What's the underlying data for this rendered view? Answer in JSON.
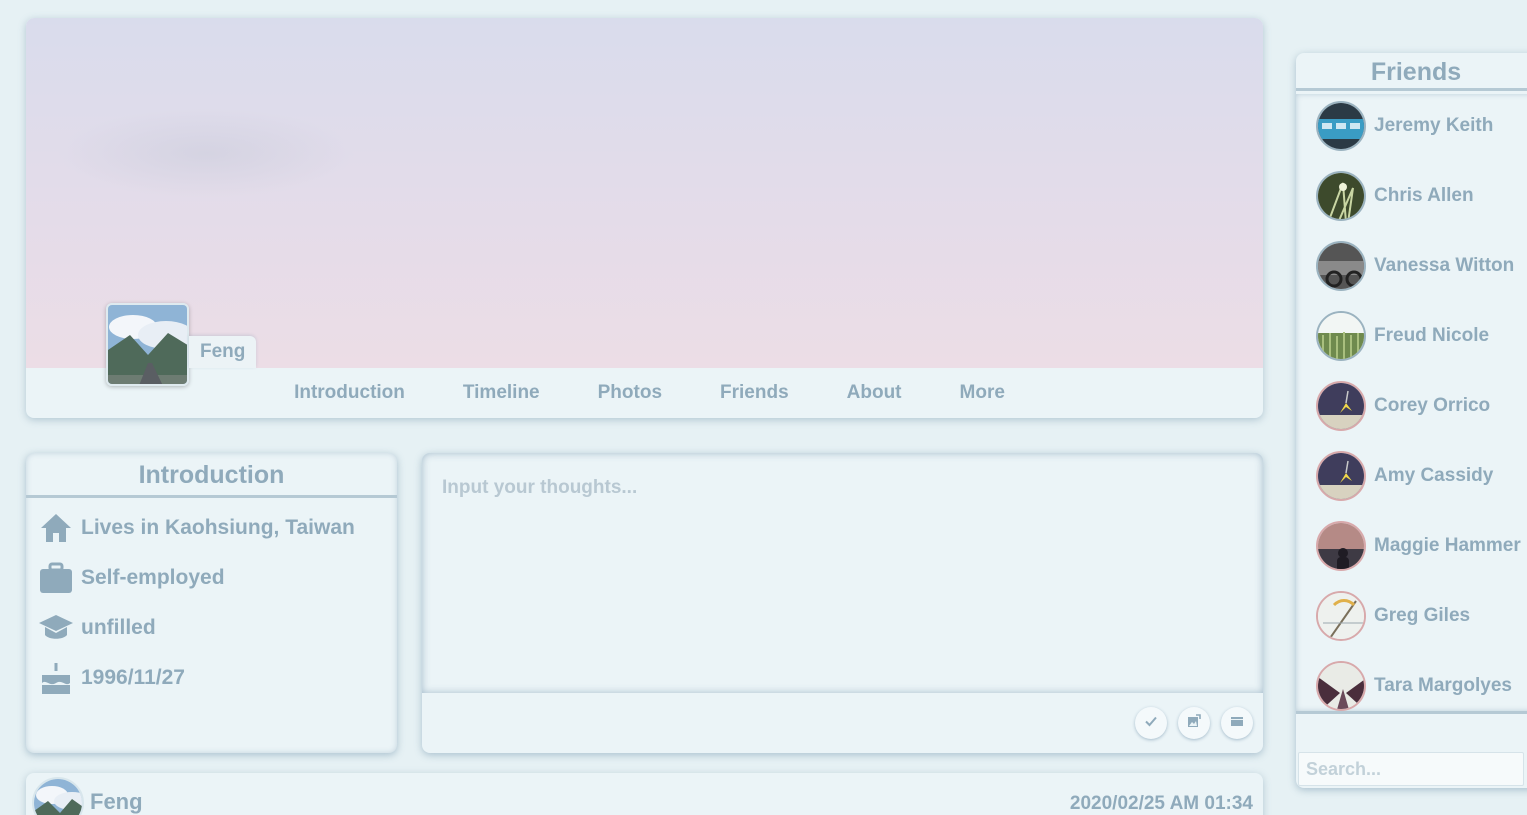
{
  "profile": {
    "name": "Feng",
    "nav_tabs": [
      "Introduction",
      "Timeline",
      "Photos",
      "Friends",
      "About",
      "More"
    ]
  },
  "intro": {
    "title": "Introduction",
    "items": [
      {
        "icon": "home-icon",
        "text": "Lives in Kaohsiung, Taiwan"
      },
      {
        "icon": "briefcase-icon",
        "text": "Self-employed"
      },
      {
        "icon": "graduation-cap-icon",
        "text": "unfilled"
      },
      {
        "icon": "birthday-cake-icon",
        "text": "1996/11/27"
      }
    ]
  },
  "composer": {
    "placeholder": "Input your thoughts...",
    "actions": [
      "check-icon",
      "image-icon",
      "video-icon"
    ]
  },
  "post": {
    "author": "Feng",
    "timestamp": "2020/02/25 AM 01:34"
  },
  "friends": {
    "title": "Friends",
    "items": [
      {
        "name": "Jeremy Keith"
      },
      {
        "name": "Chris Allen"
      },
      {
        "name": "Vanessa Witton"
      },
      {
        "name": "Freud Nicole"
      },
      {
        "name": "Corey Orrico"
      },
      {
        "name": "Amy Cassidy"
      },
      {
        "name": "Maggie Hammer"
      },
      {
        "name": "Greg Giles"
      },
      {
        "name": "Tara Margolyes"
      }
    ],
    "search_placeholder": "Search..."
  },
  "colors": {
    "background": "#e6f1f4",
    "card": "#ebf4f7",
    "text": "#8faabb",
    "divider": "#b5c9d4"
  }
}
